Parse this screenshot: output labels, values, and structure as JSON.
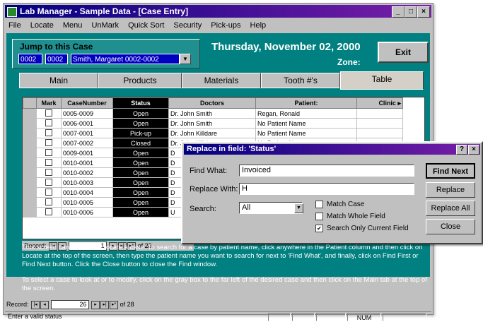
{
  "window": {
    "title": "Lab Manager - Sample Data - [Case Entry]"
  },
  "menu": [
    "File",
    "Locate",
    "Menu",
    "UnMark",
    "Quick Sort",
    "Security",
    "Pick-ups",
    "Help"
  ],
  "jump": {
    "label": "Jump to this Case",
    "field1": "0002",
    "field2": "0002",
    "name": "Smith, Margaret 0002-0002"
  },
  "header": {
    "date": "Thursday, November 02, 2000",
    "zone": "Zone:",
    "exit": "Exit"
  },
  "tabs": [
    "Main",
    "Products",
    "Materials",
    "Tooth #'s",
    "Table"
  ],
  "grid": {
    "columns": [
      "Mark",
      "CaseNumber",
      "Status",
      "Doctors",
      "Patient:",
      "Clinic"
    ],
    "rows": [
      [
        "0005-0009",
        "Open",
        "Dr. John Smith",
        "Regan, Ronald"
      ],
      [
        "0006-0001",
        "Open",
        "Dr. John Smith",
        "No Patient Name"
      ],
      [
        "0007-0001",
        "Pick-up",
        "Dr. John Killdare",
        "No Patient Name"
      ],
      [
        "0007-0002",
        "Closed",
        "Dr. John Killdare",
        "No Patient Name"
      ],
      [
        "0009-0001",
        "Open",
        "D",
        ""
      ],
      [
        "0010-0001",
        "Open",
        "D",
        ""
      ],
      [
        "0010-0002",
        "Open",
        "D",
        ""
      ],
      [
        "0010-0003",
        "Open",
        "D",
        ""
      ],
      [
        "0010-0004",
        "Open",
        "D",
        ""
      ],
      [
        "0010-0005",
        "Open",
        "D",
        ""
      ],
      [
        "0010-0006",
        "Open",
        "U",
        ""
      ]
    ]
  },
  "record_nav": {
    "label": "Record:",
    "value": "1",
    "of": "of 28"
  },
  "help": {
    "p1": "This screen can be used to locate a case.  To search for a case by patient name, click anywhere in the Patient column and then click on Locate at the top of the screen, then type the patient name you want to search for next to 'Find What', and finally, click on Find First or Find Next button.  Click the Close button to close the Find window.",
    "p2": "To select a case to look at or to modify, click on the gray box to the far left of the desired case and then click on the Main tab at the top of the screen."
  },
  "record_nav2": {
    "label": "Record:",
    "value": "26",
    "of": "of  28"
  },
  "status_bar": {
    "text": "Enter a valid status",
    "num": "NUM"
  },
  "dialog": {
    "title": "Replace in field: 'Status'",
    "find_label": "Find What:",
    "find_value": "Invoiced",
    "replace_label": "Replace With:",
    "replace_value": "H",
    "search_label": "Search:",
    "search_value": "All",
    "match_case": "Match Case",
    "match_whole": "Match Whole Field",
    "search_only": "Search Only Current Field",
    "btn_find_next": "Find Next",
    "btn_replace": "Replace",
    "btn_replace_all": "Replace All",
    "btn_close": "Close"
  }
}
